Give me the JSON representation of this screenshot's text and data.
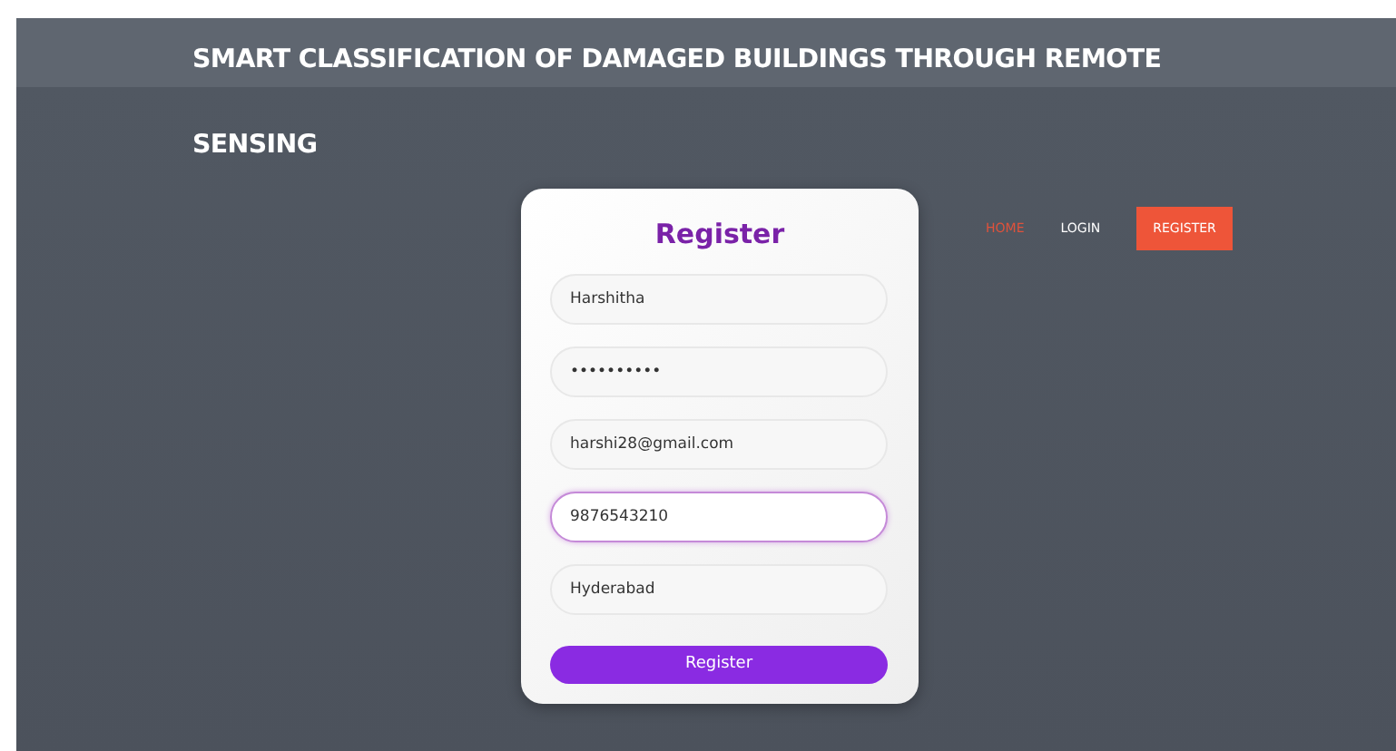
{
  "header": {
    "title": "SMART CLASSIFICATION OF DAMAGED BUILDINGS THROUGH REMOTE SENSING"
  },
  "form": {
    "title": "Register",
    "fields": [
      {
        "value": "Harshitha",
        "focused": false
      },
      {
        "value": "••••••••••",
        "focused": false
      },
      {
        "value": "harshi28@gmail.com",
        "focused": false
      },
      {
        "value": "9876543210",
        "focused": true
      },
      {
        "value": "Hyderabad",
        "focused": false
      }
    ],
    "submit": "Register"
  },
  "nav": [
    {
      "label": "HOME",
      "kind": "link",
      "selected": true
    },
    {
      "label": "LOGIN",
      "kind": "link",
      "selected": false
    },
    {
      "label": "REGISTER",
      "kind": "button",
      "selected": false
    }
  ]
}
